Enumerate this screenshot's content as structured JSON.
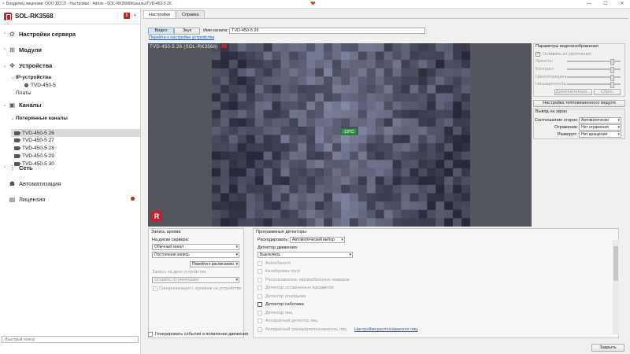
{
  "titlebar": {
    "text": "Владелец лицензии: ООО ДССЛ - Настройки - Admin - SOL-RK3568/Каналы/TVD-450-5 26",
    "back": "<",
    "heart": "❤",
    "min": "—",
    "max": "☐",
    "close": "✕"
  },
  "server": {
    "name": "SOL-RK3568",
    "badge": "5",
    "chevron": "▾"
  },
  "tree": {
    "server_settings": "Настройки сервера",
    "modules": "Модули",
    "devices": "Устройства",
    "ip_devices": "IP-устройства",
    "ip_device_1": "TVD-450-5",
    "boards": "Платы",
    "channels": "Каналы",
    "lost_channels": "Потерянные каналы",
    "channel_items": [
      "TVD-450-5 26",
      "TVD-450-5 27",
      "TVD-450-5 28",
      "TVD-450-5 29",
      "TVD-450-5 30"
    ],
    "network": "Сеть",
    "automation": "Автоматизация",
    "license": "Лицензия"
  },
  "quick_search": {
    "placeholder": "(Быстрый поиск)"
  },
  "tabs": {
    "settings": "Настройки",
    "help": "Справка"
  },
  "channel": {
    "video_btn": "Видео",
    "audio_btn": "Звук",
    "name_label": "Имя канала:",
    "name_value": "TVD-450-5 26",
    "device_link": "Перейти к настройке устройства"
  },
  "video": {
    "caption": "TVD-450-5 26 (SOL-RK3568)",
    "temperature": "13°C",
    "logo": "R"
  },
  "image_params": {
    "title": "Параметры видеоизображения",
    "keep_default": "Оставить по умолчанию",
    "brightness": "Яркость:",
    "contrast": "Контраст:",
    "color": "Цветопередача:",
    "saturation": "Насыщенность:",
    "advanced_btn": "Дополнительно...",
    "reset_btn": "Сброс",
    "thermal_btn": "Настройка тепловизионного модуля"
  },
  "screen_output": {
    "title": "Вывод на экран",
    "aspect_label": "Соотношение сторон:",
    "aspect_value": "Автоматически",
    "mirror_label": "Отражение:",
    "mirror_value": "Нет отражения",
    "rotate_label": "Разворот:",
    "rotate_value": "Нет вращения"
  },
  "archive": {
    "title": "Запись архива",
    "server_disks": "На диски сервера:",
    "channel_type": "Обычный канал",
    "record_mode": "Постоянная запись",
    "schedule_btn": "Перейти к расписанию",
    "device_disk": "Запись на диск устройства",
    "device_default": "Оставить по умолчанию",
    "sync": "Синхронизация с архивом на устройстве",
    "generate_events": "Генерировать события о появлении движения"
  },
  "detectors": {
    "title": "Программные детекторы",
    "decode_label": "Раскодировать:",
    "decode_value": "Автоматический выбор",
    "motion_label": "Детектор движения:",
    "motion_value": "Выключить",
    "items": [
      "ActiveSearch",
      "Калибровка поля",
      "Распознаватель автомобильных номеров",
      "Детектор оставленных предметов",
      "Детектор огня/дыма",
      "Детектор саботажа",
      "Детектор лиц",
      "Аппаратный детектор лиц",
      "Аппаратный трекер/распознаватель лиц"
    ],
    "face_link": "Настройки распознавателя лиц"
  },
  "footer": {
    "close_btn": "Закрыть"
  }
}
